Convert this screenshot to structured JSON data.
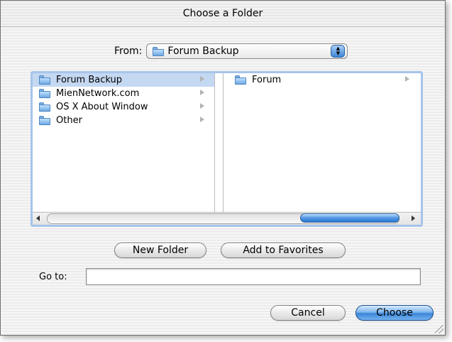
{
  "dialog": {
    "title": "Choose a Folder"
  },
  "from": {
    "label": "From:",
    "selected": "Forum Backup",
    "icon": "folder-icon"
  },
  "browser": {
    "column1": [
      {
        "label": "Forum Backup",
        "selected": true
      },
      {
        "label": "MienNetwork.com",
        "selected": false
      },
      {
        "label": "OS X About Window",
        "selected": false
      },
      {
        "label": "Other",
        "selected": false
      }
    ],
    "column3": [
      {
        "label": "Forum",
        "selected": false
      }
    ]
  },
  "actions": {
    "new_folder": "New Folder",
    "add_favorites": "Add to Favorites"
  },
  "goto": {
    "label": "Go to:",
    "value": ""
  },
  "footer": {
    "cancel": "Cancel",
    "choose": "Choose"
  },
  "colors": {
    "selection": "#c5d8f2",
    "focus_ring": "#a6c4ea",
    "default_button": "#3b86d8"
  }
}
